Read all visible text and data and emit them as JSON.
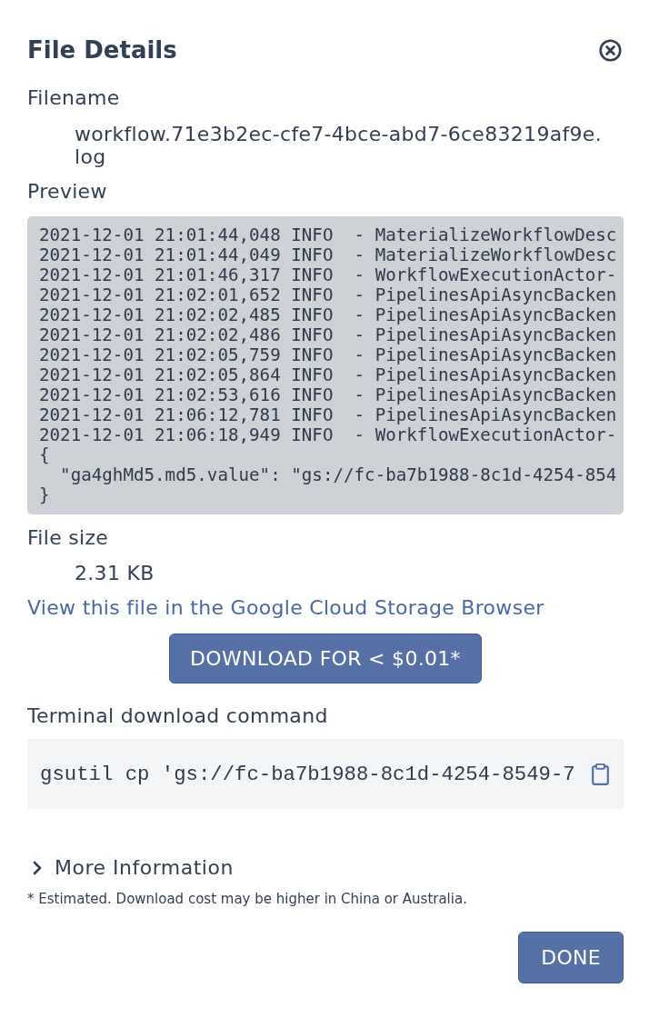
{
  "title": "File Details",
  "filename": {
    "label": "Filename",
    "value": "workflow.71e3b2ec-cfe7-4bce-abd7-6ce83219af9e.log"
  },
  "preview": {
    "label": "Preview",
    "lines": [
      "2021-12-01 21:01:44,048 INFO  - MaterializeWorkflowDesc",
      "2021-12-01 21:01:44,049 INFO  - MaterializeWorkflowDesc",
      "2021-12-01 21:01:46,317 INFO  - WorkflowExecutionActor-",
      "2021-12-01 21:02:01,652 INFO  - PipelinesApiAsyncBacken",
      "2021-12-01 21:02:02,485 INFO  - PipelinesApiAsyncBacken",
      "2021-12-01 21:02:02,486 INFO  - PipelinesApiAsyncBacken",
      "2021-12-01 21:02:05,759 INFO  - PipelinesApiAsyncBacken",
      "2021-12-01 21:02:05,864 INFO  - PipelinesApiAsyncBacken",
      "2021-12-01 21:02:53,616 INFO  - PipelinesApiAsyncBacken",
      "2021-12-01 21:06:12,781 INFO  - PipelinesApiAsyncBacken",
      "2021-12-01 21:06:18,949 INFO  - WorkflowExecutionActor-",
      "{",
      "  \"ga4ghMd5.md5.value\": \"gs://fc-ba7b1988-8c1d-4254-854",
      "}"
    ]
  },
  "file_size": {
    "label": "File size",
    "value": "2.31 KB"
  },
  "storage_link": "View this file in the Google Cloud Storage Browser",
  "download_button": "DOWNLOAD FOR < $0.01*",
  "terminal": {
    "label": "Terminal download command",
    "command": "gsutil cp 'gs://fc-ba7b1988-8c1d-4254-8549-7"
  },
  "more_information": {
    "label": "More Information",
    "expanded": false
  },
  "footnote": "* Estimated. Download cost may be higher in China or Australia.",
  "done_button": "DONE"
}
